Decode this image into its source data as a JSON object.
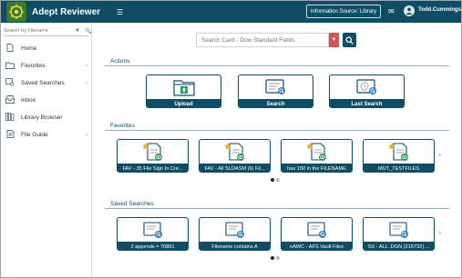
{
  "header": {
    "app_title": "Adept Reviewer",
    "info_source_label": "Information Source: Library",
    "user_name": "Todd.Cummings"
  },
  "sidebar": {
    "search_placeholder": "Search by Filename",
    "items": [
      {
        "label": "Home",
        "icon": "document-icon",
        "has_chevron": false
      },
      {
        "label": "Favorites",
        "icon": "folder-icon",
        "has_chevron": true
      },
      {
        "label": "Saved Searches",
        "icon": "saved-search-icon",
        "has_chevron": true
      },
      {
        "label": "Inbox",
        "icon": "inbox-icon",
        "has_chevron": false
      },
      {
        "label": "Library Browser",
        "icon": "library-icon",
        "has_chevron": false
      },
      {
        "label": "File Guide",
        "icon": "file-guide-icon",
        "has_chevron": true
      }
    ]
  },
  "search": {
    "placeholder": "Search Card - Dow Standard Fields"
  },
  "actions": {
    "title": "Actions",
    "items": [
      {
        "label": "Upload",
        "icon": "upload-folder-icon"
      },
      {
        "label": "Search",
        "icon": "search-card-icon"
      },
      {
        "label": "Last Search",
        "icon": "last-search-icon"
      }
    ]
  },
  "favorites": {
    "title": "Favorites",
    "items": [
      {
        "label": "FAV - 35 File Sign In Cre..."
      },
      {
        "label": "FAV - All SLDASM (6) Fil..."
      },
      {
        "label": "has 150 in the FILENAME"
      },
      {
        "label": "MUT_TESTFILES"
      }
    ]
  },
  "saved_searches": {
    "title": "Saved Searches",
    "items": [
      {
        "label": "2 appends = 70891"
      },
      {
        "label": "Filename contains A"
      },
      {
        "label": "nAWC - AFS Vault Files"
      },
      {
        "label": "SS - ALL .DGN (216732) ..."
      }
    ]
  },
  "colors": {
    "primary": "#0e4d63",
    "accent_red": "#d9534f",
    "logo_green": "#3b7a2a",
    "eye_green": "#2e9b5e",
    "star_gold": "#f0ad2b"
  }
}
